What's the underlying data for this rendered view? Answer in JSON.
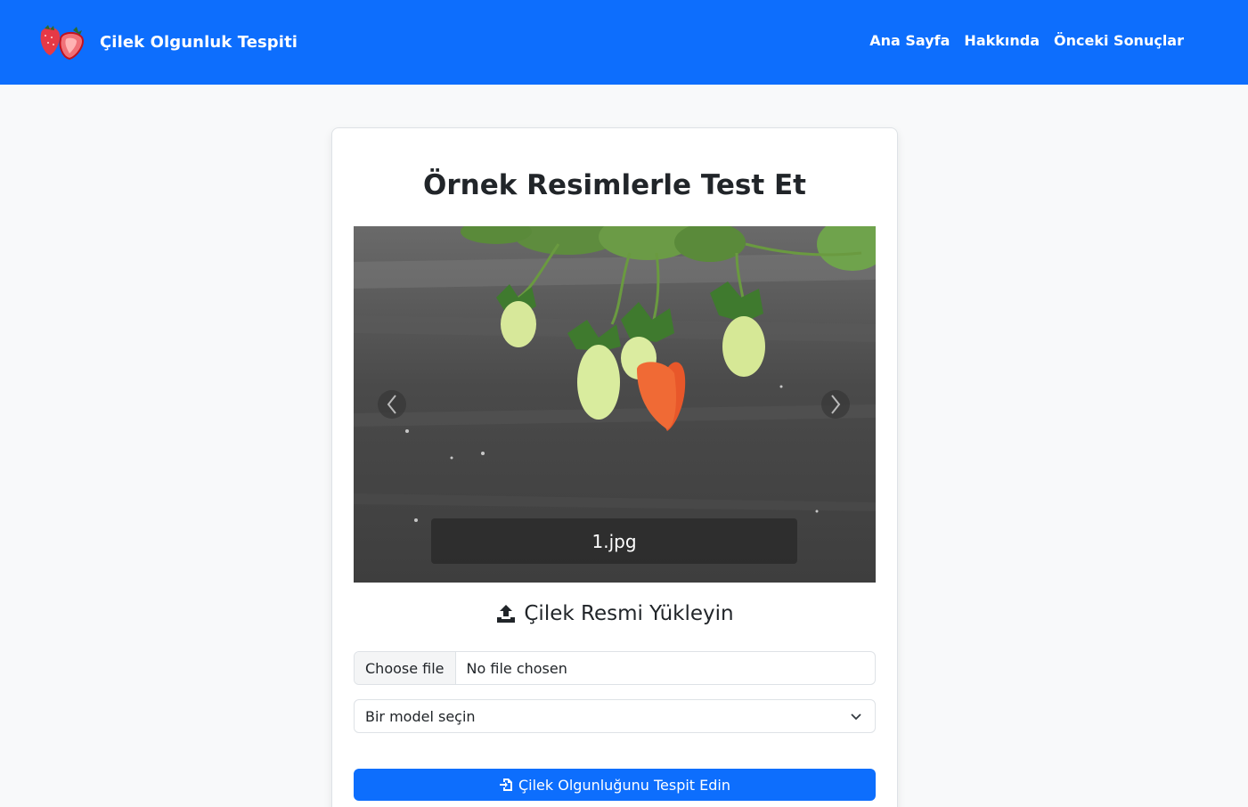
{
  "navbar": {
    "brand": "Çilek Olgunluk Tespiti",
    "links": [
      "Ana Sayfa",
      "Hakkında",
      "Önceki Sonuçlar"
    ]
  },
  "card": {
    "title": "Örnek Resimlerle Test Et",
    "carousel": {
      "caption": "1.jpg"
    },
    "upload_title": "Çilek Resmi Yükleyin",
    "file_button": "Choose file",
    "file_status": "No file chosen",
    "model_select": "Bir model seçin",
    "submit_label": "Çilek Olgunluğunu Tespit Edin"
  },
  "colors": {
    "primary": "#0d6efd",
    "background": "#f8f9fa"
  },
  "icons": [
    "strawberry-logo-icon",
    "chevron-left-icon",
    "chevron-right-icon",
    "upload-icon",
    "chevron-down-icon",
    "file-import-icon"
  ]
}
